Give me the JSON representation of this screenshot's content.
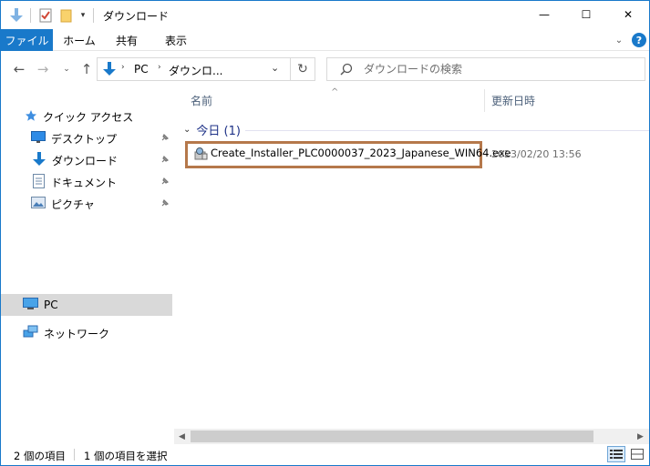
{
  "window": {
    "title": "ダウンロード",
    "controls": {
      "minimize": "—",
      "maximize": "☐",
      "close": "✕"
    }
  },
  "ribbon": {
    "tabs": [
      "ファイル",
      "ホーム",
      "共有",
      "表示"
    ]
  },
  "navigation": {
    "back_icon": "arrow-left-icon",
    "forward_icon": "arrow-right-icon",
    "recent_icon": "chevron-down-icon",
    "up_icon": "arrow-up-icon",
    "breadcrumb": [
      "PC",
      "ダウンロ..."
    ],
    "refresh_icon": "refresh-icon",
    "search_placeholder": "ダウンロードの検索"
  },
  "sidebar": {
    "quick_access_label": "クイック アクセス",
    "items": [
      {
        "label": "デスクトップ",
        "icon": "desktop-icon",
        "pinned": true
      },
      {
        "label": "ダウンロード",
        "icon": "download-icon",
        "pinned": true
      },
      {
        "label": "ドキュメント",
        "icon": "document-icon",
        "pinned": true
      },
      {
        "label": "ピクチャ",
        "icon": "pictures-icon",
        "pinned": true
      }
    ],
    "pc_label": "PC",
    "network_label": "ネットワーク"
  },
  "content": {
    "columns": {
      "name": "名前",
      "date_modified": "更新日時"
    },
    "group_label": "今日 (1)",
    "files": [
      {
        "name": "Create_Installer_PLC0000037_2023_Japanese_WIN64.exe",
        "modified": "2023/02/20 13:56",
        "icon": "installer-icon"
      }
    ]
  },
  "status": {
    "item_count": "2 個の項目",
    "selected": "1 個の項目を選択"
  },
  "colors": {
    "accent": "#1979ca",
    "highlight_border": "#b5784b",
    "group_text": "#1e3287"
  }
}
